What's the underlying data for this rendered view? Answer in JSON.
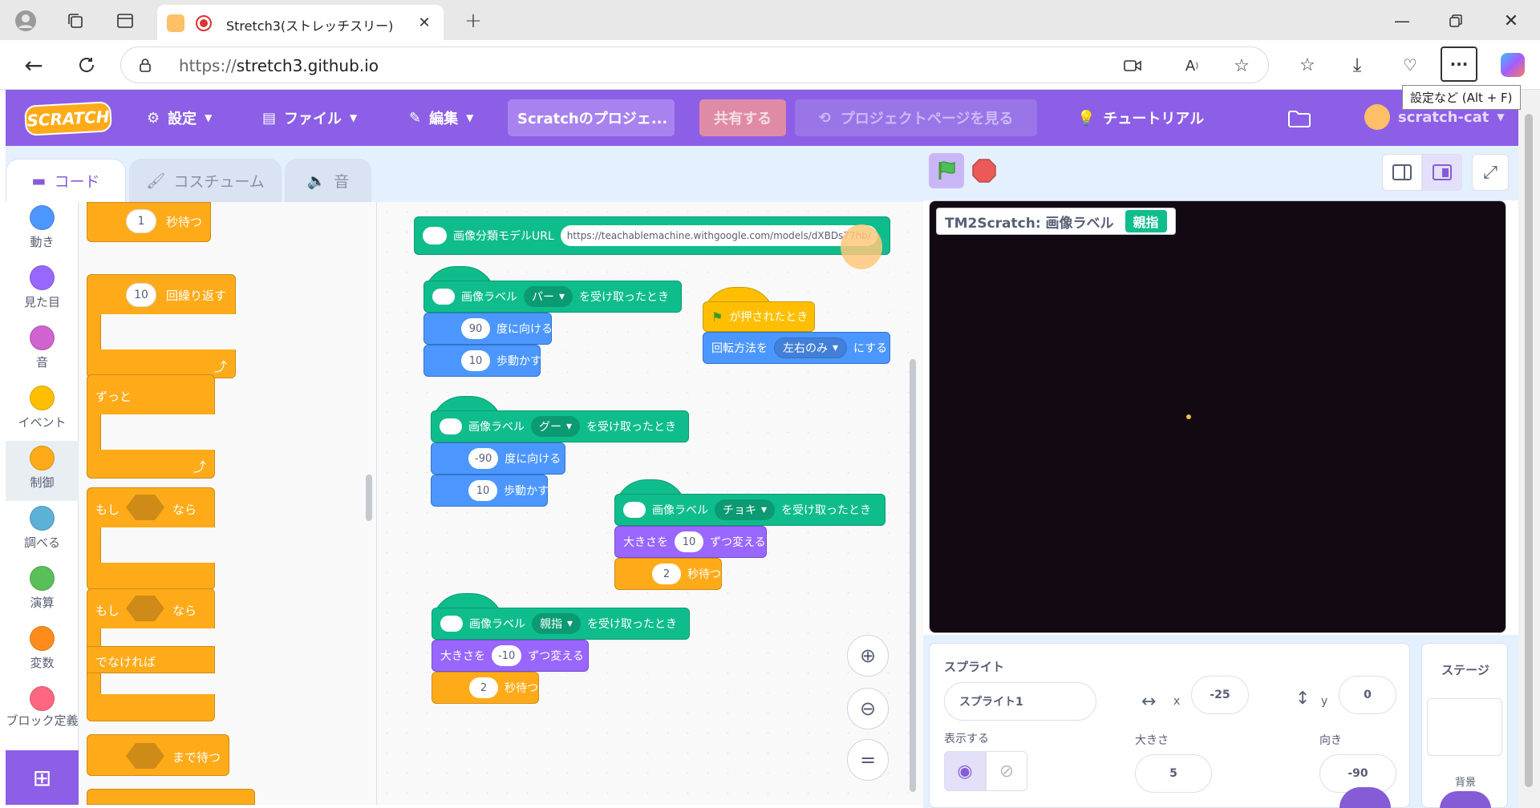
{
  "browser": {
    "tab_title": "Stretch3(ストレッチスリー)",
    "url_prefix": "https://",
    "url_host": "stretch3.github.io",
    "tooltip": "設定など (Alt + F)"
  },
  "menu": {
    "logo": "SCRATCH",
    "settings": "設定",
    "file": "ファイル",
    "edit": "編集",
    "project_title": "Scratchのプロジェ...",
    "share": "共有する",
    "project_page": "プロジェクトページを見る",
    "tutorials": "チュートリアル",
    "username": "scratch-cat"
  },
  "tabs": {
    "code": "コード",
    "costume": "コスチューム",
    "sound": "音"
  },
  "categories": [
    {
      "label": "動き",
      "color": "#4c97ff"
    },
    {
      "label": "見た目",
      "color": "#9966ff"
    },
    {
      "label": "音",
      "color": "#cf63cf"
    },
    {
      "label": "イベント",
      "color": "#ffbf00"
    },
    {
      "label": "制御",
      "color": "#ffab19"
    },
    {
      "label": "調べる",
      "color": "#5cb1d6"
    },
    {
      "label": "演算",
      "color": "#59c059"
    },
    {
      "label": "変数",
      "color": "#ff8c1a"
    },
    {
      "label": "ブロック定義",
      "color": "#ff6680"
    }
  ],
  "palette": {
    "wait_value": "1",
    "wait_label": "秒待つ",
    "repeat_value": "10",
    "repeat_label": "回繰り返す",
    "forever_label": "ずっと",
    "if_label": "もし",
    "then_label": "なら",
    "if2_label": "もし",
    "then2_label": "なら",
    "else_label": "でなければ",
    "wait_until_label": "まで待つ"
  },
  "workspace": {
    "model_block": {
      "label": "画像分類モデルURL",
      "url": "https://teachablemachine.withgoogle.com/models/dXBDs77hb/"
    },
    "script1": {
      "hat_label": "画像ラベル",
      "dropdown": "パー",
      "hat_suffix": "を受け取ったとき",
      "dir_value": "90",
      "dir_label": "度に向ける",
      "move_value": "10",
      "move_label": "歩動かす"
    },
    "script2": {
      "hat_label": "画像ラベル",
      "dropdown": "グー",
      "hat_suffix": "を受け取ったとき",
      "dir_value": "-90",
      "dir_label": "度に向ける",
      "move_value": "10",
      "move_label": "歩動かす"
    },
    "script3": {
      "hat_label": "画像ラベル",
      "dropdown": "チョキ",
      "hat_suffix": "を受け取ったとき",
      "size_prefix": "大きさを",
      "size_value": "10",
      "size_label": "ずつ変える",
      "wait_value": "2",
      "wait_label": "秒待つ"
    },
    "script4": {
      "hat_label": "画像ラベル",
      "dropdown": "親指",
      "hat_suffix": "を受け取ったとき",
      "size_prefix": "大きさを",
      "size_value": "-10",
      "size_label": "ずつ変える",
      "wait_value": "2",
      "wait_label": "秒待つ"
    },
    "flag_script": {
      "hat_label": "が押されたとき",
      "rot_prefix": "回転方法を",
      "rot_value": "左右のみ",
      "rot_suffix": "にする"
    }
  },
  "stage": {
    "monitor_label": "TM2Scratch: 画像ラベル",
    "monitor_value": "親指"
  },
  "sprite_info": {
    "title": "スプライト",
    "name": "スプライト1",
    "x_label": "x",
    "x": "-25",
    "y_label": "y",
    "y": "0",
    "show_label": "表示する",
    "size_label": "大きさ",
    "size": "5",
    "direction_label": "向き",
    "direction": "-90"
  },
  "stage_panel": {
    "title": "ステージ",
    "backdrop_label": "背景"
  }
}
